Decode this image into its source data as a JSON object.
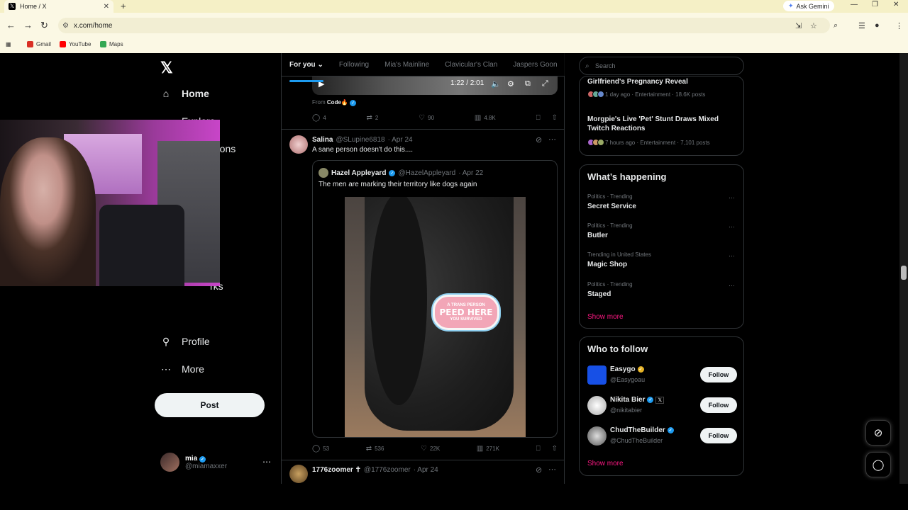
{
  "browser": {
    "tab_title": "Home / X",
    "tab_close": "✕",
    "new_tab": "+",
    "ask_gemini": "Ask Gemini",
    "url": "x.com/home",
    "bookmarks": [
      {
        "label": "Gmail",
        "color": "#d93025"
      },
      {
        "label": "YouTube",
        "color": "#ff0000"
      },
      {
        "label": "Maps",
        "color": "#34a853"
      }
    ]
  },
  "nav": {
    "items": [
      {
        "label": "Home",
        "icon": "home-icon"
      },
      {
        "label": "Explore",
        "icon": "search-icon"
      },
      {
        "label": "Notifications",
        "icon": "bell-icon"
      },
      {
        "label": "rks",
        "icon": "bookmark-icon"
      },
      {
        "label": "Profile",
        "icon": "person-icon"
      },
      {
        "label": "More",
        "icon": "more-circle-icon"
      }
    ],
    "post_label": "Post",
    "account": {
      "name": "mia",
      "handle": "@miamaxxer"
    }
  },
  "feed": {
    "tabs": [
      "For you",
      "Following",
      "Mia's Mainline",
      "Clavicular's Clan",
      "Jaspers Goon"
    ],
    "video": {
      "time": "1:22 / 2:01"
    },
    "from_prefix": "From",
    "from_name": "Code🔥",
    "first_stats": {
      "replies": "4",
      "reposts": "2",
      "likes": "90",
      "views": "4.8K"
    },
    "tweet": {
      "name": "Salina",
      "handle": "@SLupine6818",
      "date": "· Apr 24",
      "text": "A sane person doesn't do this....",
      "quote": {
        "name": "Hazel Appleyard",
        "handle": "@HazelAppleyard",
        "date": "· Apr 22",
        "text": "The men are marking their territory like dogs again",
        "sticker_top": "A TRANS PERSON",
        "sticker_main": "PEED HERE",
        "sticker_bottom": "YOU SURVIVED"
      },
      "stats": {
        "replies": "53",
        "reposts": "536",
        "likes": "22K",
        "views": "271K"
      }
    },
    "next_tweet": {
      "name": "1776zoomer ✝",
      "handle": "@1776zoomer",
      "date": "· Apr 24"
    }
  },
  "sidebar": {
    "search_placeholder": "Search",
    "news": [
      {
        "title": "Girlfriend's Pregnancy Reveal",
        "meta": "1 day ago · Entertainment · 18.6K posts"
      },
      {
        "title": "Morgpie's Live 'Pet' Stunt Draws Mixed Twitch Reactions",
        "meta": "7 hours ago · Entertainment · 7,101 posts"
      }
    ],
    "happening_title": "What’s happening",
    "trends": [
      {
        "category": "Politics · Trending",
        "name": "Secret Service"
      },
      {
        "category": "Politics · Trending",
        "name": "Butler"
      },
      {
        "category": "Trending in United States",
        "name": "Magic Shop"
      },
      {
        "category": "Politics · Trending",
        "name": "Staged"
      }
    ],
    "show_more": "Show more",
    "wtf_title": "Who to follow",
    "follow": [
      {
        "name": "Easygo",
        "handle": "@Easygoau",
        "button": "Follow"
      },
      {
        "name": "Nikita Bier",
        "handle": "@nikitabier",
        "button": "Follow"
      },
      {
        "name": "ChudTheBuilder",
        "handle": "@ChudTheBuilder",
        "button": "Follow"
      }
    ]
  },
  "colors": {
    "accent": "#1d9bf0",
    "show_more": "#f91880",
    "background": "#000000"
  }
}
